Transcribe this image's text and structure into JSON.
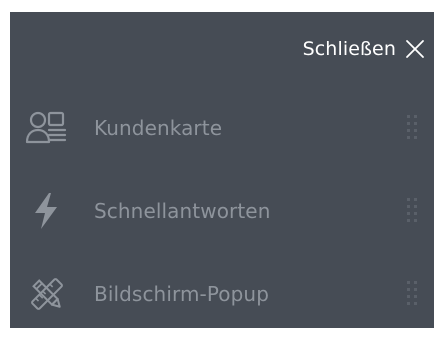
{
  "header": {
    "close_label": "Schließen"
  },
  "menu": {
    "items": [
      {
        "label": "Kundenkarte",
        "icon": "customer-card-icon"
      },
      {
        "label": "Schnellantworten",
        "icon": "lightning-bolt-icon"
      },
      {
        "label": "Bildschirm-Popup",
        "icon": "design-tools-icon"
      }
    ]
  },
  "colors": {
    "panel_background": "#464c55",
    "label_muted": "#8e949c",
    "close_text": "#ffffff",
    "icon_muted": "#8e949c",
    "drag_dots": "#5a6069"
  }
}
